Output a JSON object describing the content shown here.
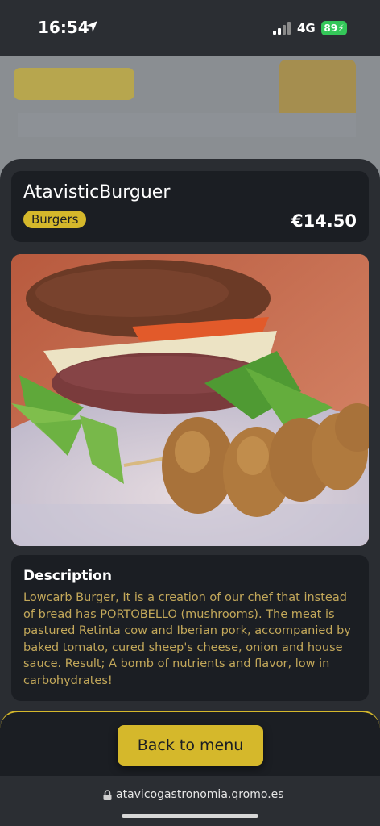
{
  "status_bar": {
    "time": "16:54",
    "network": "4G",
    "battery": "89",
    "icons": [
      "location-arrow-icon",
      "signal-icon",
      "battery-charging-icon"
    ]
  },
  "product": {
    "title": "AtavisticBurguer",
    "category": "Burgers",
    "price": "€14.50",
    "image_alt": "burger-photo"
  },
  "description": {
    "heading": "Description",
    "text": "Lowcarb Burger, It is a creation of our chef that instead of bread has PORTOBELLO (mushrooms). The meat is pastured Retinta cow and Iberian pork, accompanied by baked tomato, cured sheep's cheese, onion and house sauce. Result; A bomb of nutrients and flavor, low in carbohydrates!"
  },
  "actions": {
    "back_label": "Back to menu"
  },
  "browser": {
    "url": "atavicogastronomia.qromo.es",
    "lock_icon": "lock-icon"
  },
  "colors": {
    "accent": "#d5b82b",
    "background": "#1b1e23",
    "sheet": "#2a2d32",
    "description_text": "#c3a85a"
  }
}
